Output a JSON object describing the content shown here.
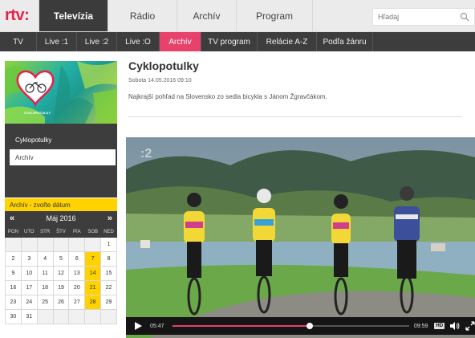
{
  "brand": {
    "logo": "rtv:",
    "accent": "#e8214a",
    "pink": "#e8416b",
    "yellow": "#ffd200"
  },
  "top_nav": {
    "tabs": [
      {
        "label": "Televízia",
        "active": true
      },
      {
        "label": "Rádio",
        "active": false
      },
      {
        "label": "Archív",
        "active": false
      },
      {
        "label": "Program",
        "active": false
      }
    ],
    "search_placeholder": "Hľadaj",
    "search_icon": "magnifier-icon"
  },
  "sub_nav": {
    "tabs": [
      {
        "label": "TV"
      },
      {
        "label": "Live :1"
      },
      {
        "label": "Live :2"
      },
      {
        "label": "Live :O"
      },
      {
        "label": "Archív",
        "active": true
      },
      {
        "label": "TV program"
      },
      {
        "label": "Relácie A-Z"
      },
      {
        "label": "Podľa žánru"
      }
    ]
  },
  "sidebar": {
    "show_name": "Cyklopotulky",
    "archive_button": "Archív",
    "thumbnail_logo_text": "CYKLOPOTULKY"
  },
  "calendar": {
    "heading": "Archív - zvoľte dátum",
    "month": "Máj 2016",
    "prev_icon": "double-chevron-left-icon",
    "next_icon": "double-chevron-right-icon",
    "weekdays": [
      "PON",
      "UTO",
      "STR",
      "ŠTV",
      "PIA",
      "SOB",
      "NED"
    ],
    "weeks": [
      [
        "",
        "",
        "",
        "",
        "",
        "",
        "1"
      ],
      [
        "2",
        "3",
        "4",
        "5",
        "6",
        "7",
        "8"
      ],
      [
        "9",
        "10",
        "11",
        "12",
        "13",
        "14",
        "15"
      ],
      [
        "16",
        "17",
        "18",
        "19",
        "20",
        "21",
        "22"
      ],
      [
        "23",
        "24",
        "25",
        "26",
        "27",
        "28",
        "29"
      ],
      [
        "30",
        "31",
        "",
        "",
        "",
        "",
        ""
      ]
    ],
    "available": [
      "7",
      "14",
      "21",
      "28"
    ]
  },
  "episode": {
    "title": "Cyklopotulky",
    "date": "Sobota 14.05.2016 09:10",
    "description": "Najkrajší pohľad na Slovensko zo sedla bicykla s Jánom Žgravčákom."
  },
  "player": {
    "watermark": ":2",
    "current_time": "05:47",
    "duration": "09:59",
    "progress": 0.58,
    "hd_label": "HD",
    "play_icon": "play-icon",
    "volume_icon": "volume-icon",
    "fullscreen_icon": "fullscreen-icon"
  }
}
